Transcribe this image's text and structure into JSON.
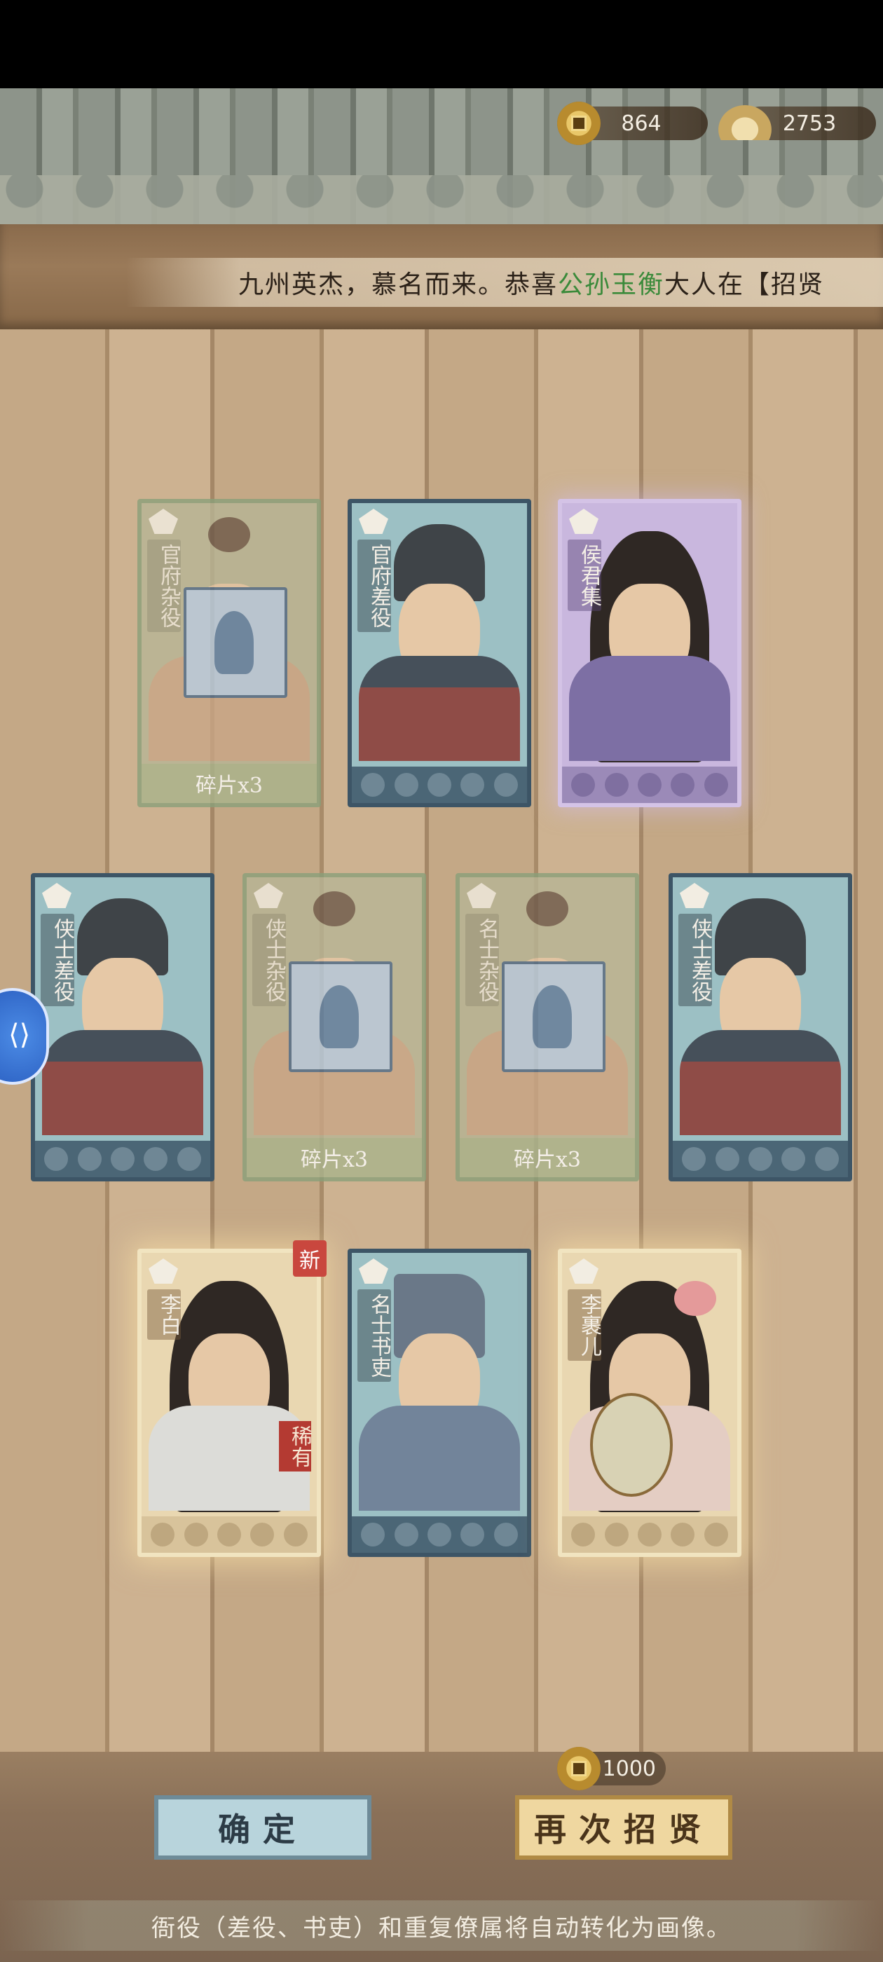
{
  "currency": {
    "coins": "864",
    "ingots": "2753",
    "coin_icon": "copper-coin-icon",
    "ingot_icon": "gold-ingot-icon"
  },
  "ticker": {
    "prefix": "九州英杰，慕名而来。恭喜",
    "player": "公孙玉衡",
    "suffix": "大人在【招贤"
  },
  "cards": {
    "row1": [
      {
        "label": "官府杂役",
        "fragment": "碎片x3"
      },
      {
        "label": "官府差役"
      },
      {
        "label": "侯君集"
      }
    ],
    "row2": [
      {
        "label": "侠士差役"
      },
      {
        "label": "侠士杂役",
        "fragment": "碎片x3"
      },
      {
        "label": "名士杂役",
        "fragment": "碎片x3"
      },
      {
        "label": "侠士差役"
      }
    ],
    "row3": [
      {
        "label": "李白",
        "new_tag": "新",
        "rare_tag": "稀有"
      },
      {
        "label": "名士书吏"
      },
      {
        "label": "李裹儿"
      }
    ]
  },
  "buttons": {
    "confirm": "确定",
    "recruit_again": "再次招贤",
    "recruit_cost": "1000"
  },
  "footer": "衙役（差役、书吏）和重复僚属将自动转化为画像。",
  "colors": {
    "highlight_green": "#3a8a3a",
    "rare_red": "#b43a32"
  }
}
